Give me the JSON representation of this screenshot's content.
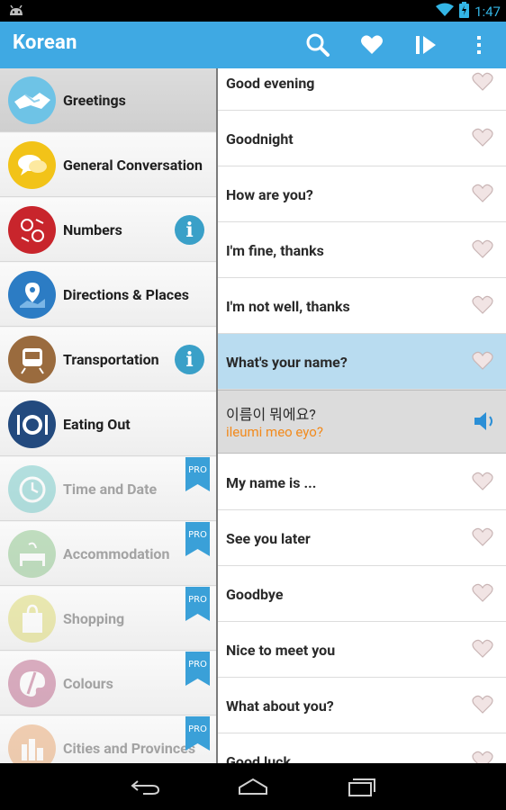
{
  "status": {
    "time": "1:47"
  },
  "app": {
    "title": "Korean"
  },
  "categories": [
    {
      "label": "Greetings"
    },
    {
      "label": "General Conversation"
    },
    {
      "label": "Numbers"
    },
    {
      "label": "Directions & Places"
    },
    {
      "label": "Transportation"
    },
    {
      "label": "Eating Out"
    },
    {
      "label": "Time and Date",
      "badge": "PRO"
    },
    {
      "label": "Accommodation",
      "badge": "PRO"
    },
    {
      "label": "Shopping",
      "badge": "PRO"
    },
    {
      "label": "Colours",
      "badge": "PRO"
    },
    {
      "label": "Cities and Provinces",
      "badge": "PRO"
    }
  ],
  "phrases": [
    "Good evening",
    "Goodnight",
    "How are you?",
    "I'm fine, thanks",
    "I'm not well, thanks",
    "What's your name?",
    "My name is ...",
    "See you later",
    "Goodbye",
    "Nice to meet you",
    "What about you?",
    "Good luck"
  ],
  "translation": {
    "korean": "이름이 뭐에요?",
    "romanization": "ileumi meo eyo?"
  },
  "colors": {
    "action_bar": "#3fa9e3",
    "selected_phrase": "#b9dcf0",
    "romanization": "#f28a1c",
    "info_button": "#3aa0c8",
    "pro_badge": "#3aa0d8"
  },
  "icons": {
    "action_bar": [
      "search-icon",
      "heart-icon",
      "play-icon",
      "overflow-menu-icon"
    ],
    "nav_bar": [
      "back-icon",
      "home-icon",
      "recent-apps-icon"
    ]
  }
}
